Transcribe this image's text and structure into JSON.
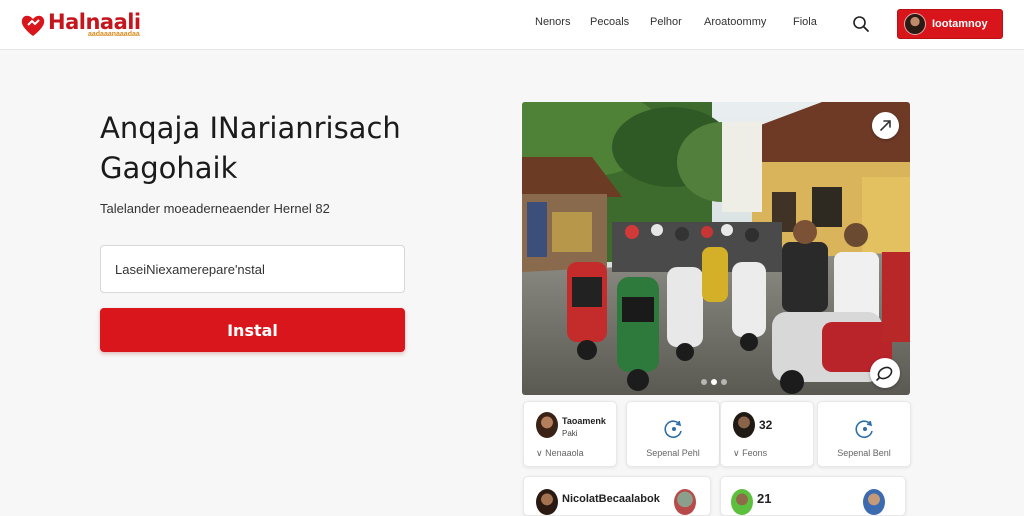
{
  "brand": {
    "name": "Halnaali",
    "tagline": "aadaaanaaadaa",
    "accent_color": "#d7151b"
  },
  "nav": {
    "items": [
      "Nenors",
      "Pecoals",
      "Pelhor",
      "Aroatoommy",
      "Fiola"
    ],
    "search_icon": "search-icon",
    "cta_label": "Iootamnoy"
  },
  "hero": {
    "title_line1": "Anqaja INarianrisach",
    "title_line2": "Gagohaik",
    "subtitle": "Talelander moeaderneaender Hernel 82",
    "input_value": "LaseiNiexamerepare'nstal",
    "install_label": "Instal"
  },
  "cards": [
    {
      "title": "Taoamenk",
      "sub": "Paki",
      "foot": "Nenaaola",
      "foot_icon": "chevron-down-icon"
    },
    {
      "foot": "Sepenal Pehl",
      "icon": "refresh-icon"
    },
    {
      "title": "32",
      "foot": "Feons",
      "foot_icon": "chevron-down-icon"
    },
    {
      "foot": "Sepenal Benl",
      "icon": "refresh-icon"
    }
  ],
  "cards_row2": [
    {
      "title": "NicolatBecaalabok"
    },
    {
      "title": "21"
    }
  ]
}
